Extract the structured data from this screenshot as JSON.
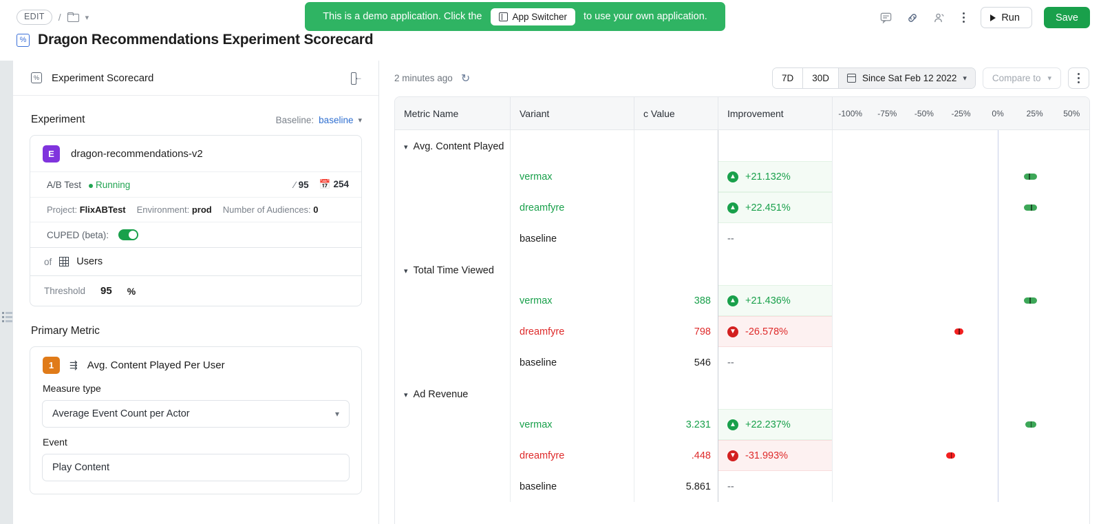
{
  "topbar": {
    "edit_label": "EDIT",
    "separator": "/",
    "banner_text_before": "This is a demo application. Click the",
    "banner_button": "App Switcher",
    "banner_text_after": "to use your own application.",
    "run_label": "Run",
    "save_label": "Save"
  },
  "title": {
    "text": "Dragon Recommendations Experiment Scorecard"
  },
  "left_panel": {
    "header_title": "Experiment Scorecard",
    "experiment_section": {
      "label": "Experiment",
      "baseline_label": "Baseline:",
      "baseline_value": "baseline",
      "badge": "E",
      "name": "dragon-recommendations-v2",
      "test_type": "A/B Test",
      "status": "Running",
      "confidence": "95",
      "days": "254",
      "project_label": "Project:",
      "project_value": "FlixABTest",
      "environment_label": "Environment:",
      "environment_value": "prod",
      "audiences_label": "Number of Audiences:",
      "audiences_value": "0",
      "cuped_label": "CUPED (beta):",
      "of_label": "of",
      "of_value": "Users",
      "threshold_label": "Threshold",
      "threshold_value": "95",
      "threshold_unit": "%"
    },
    "primary_metric": {
      "section_label": "Primary Metric",
      "badge": "1",
      "name": "Avg. Content Played Per User",
      "measure_type_label": "Measure type",
      "measure_type_value": "Average Event Count per Actor",
      "event_label": "Event",
      "event_value": "Play Content"
    }
  },
  "right_panel": {
    "refreshed": "2 minutes ago",
    "range_7d": "7D",
    "range_30d": "30D",
    "date_range": "Since Sat Feb 12 2022",
    "compare_to": "Compare to"
  },
  "chart_data": {
    "type": "bar",
    "title": "Experiment Scorecard Results",
    "columns": [
      "Metric Name",
      "Variant",
      "c Value",
      "Improvement"
    ],
    "xlabel": "",
    "ylabel": "",
    "xlim": [
      -112,
      62
    ],
    "ticks": [
      {
        "label": "-100%",
        "value": -100
      },
      {
        "label": "-75%",
        "value": -75
      },
      {
        "label": "-50%",
        "value": -50
      },
      {
        "label": "-25%",
        "value": -25
      },
      {
        "label": "0%",
        "value": 0
      },
      {
        "label": "25%",
        "value": 25
      },
      {
        "label": "50%",
        "value": 50
      }
    ],
    "groups": [
      {
        "metric": "Avg. Content Played",
        "rows": [
          {
            "variant": "vermax",
            "value": "",
            "improvement": "+21.132%",
            "sign": "pos",
            "ci_low": 17.5,
            "ci_high": 26.5,
            "ci_mid": 21.132
          },
          {
            "variant": "dreamfyre",
            "value": "",
            "improvement": "+22.451%",
            "sign": "pos",
            "ci_low": 17.5,
            "ci_high": 26.5,
            "ci_mid": 22.451
          },
          {
            "variant": "baseline",
            "value": "",
            "improvement": "--",
            "sign": "neu",
            "ci_low": null,
            "ci_high": null,
            "ci_mid": null
          }
        ]
      },
      {
        "metric": "Total Time Viewed",
        "rows": [
          {
            "variant": "vermax",
            "value": "388",
            "improvement": "+21.436%",
            "sign": "pos",
            "ci_low": 17.5,
            "ci_high": 26.5,
            "ci_mid": 21.436
          },
          {
            "variant": "dreamfyre",
            "value": "798",
            "improvement": "-26.578%",
            "sign": "neg",
            "ci_low": -29.5,
            "ci_high": -23.5,
            "ci_mid": -26.578
          },
          {
            "variant": "baseline",
            "value": "546",
            "improvement": "--",
            "sign": "neu",
            "ci_low": null,
            "ci_high": null,
            "ci_mid": null
          }
        ]
      },
      {
        "metric": "Ad Revenue",
        "rows": [
          {
            "variant": "vermax",
            "value": "3.231",
            "improvement": "+22.237%",
            "sign": "pos",
            "ci_low": 18.5,
            "ci_high": 26.0,
            "ci_mid": 22.237
          },
          {
            "variant": "dreamfyre",
            "value": ".448",
            "improvement": "-31.993%",
            "sign": "neg",
            "ci_low": -35.0,
            "ci_high": -29.0,
            "ci_mid": -31.993
          },
          {
            "variant": "baseline",
            "value": "5.861",
            "improvement": "--",
            "sign": "neu",
            "ci_low": null,
            "ci_high": null,
            "ci_mid": null
          }
        ]
      }
    ]
  }
}
